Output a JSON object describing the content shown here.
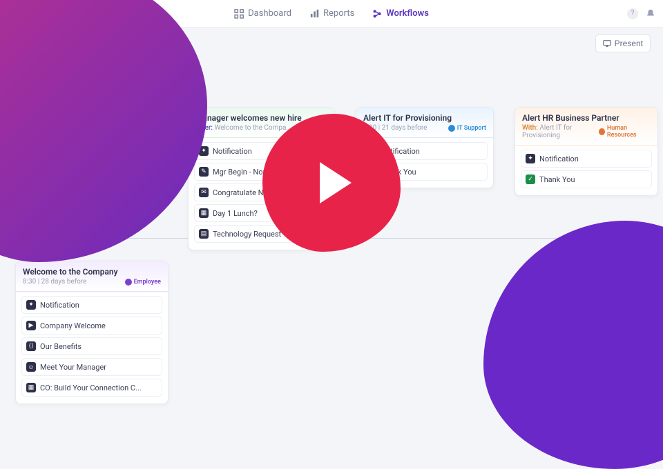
{
  "nav": {
    "items": [
      {
        "label": "Dashboard",
        "active": false
      },
      {
        "label": "Reports",
        "active": false
      },
      {
        "label": "Workflows",
        "active": true
      }
    ]
  },
  "toolbar": {
    "present_label": "Present"
  },
  "cards": {
    "welcome": {
      "title": "Welcome to the Company",
      "subtitle_time": "8:30 | 28 days before",
      "role": "Employee",
      "tasks": [
        {
          "icon": "bell",
          "label": "Notification"
        },
        {
          "icon": "play",
          "label": "Company Welcome"
        },
        {
          "icon": "code",
          "label": "Our Benefits"
        },
        {
          "icon": "user",
          "label": "Meet Your Manager"
        },
        {
          "icon": "cal",
          "label": "CO: Build Your Connection C..."
        }
      ]
    },
    "manager": {
      "title": "Manager welcomes new hire",
      "subtitle_prefix": "After:",
      "subtitle_text": "Welcome to the Compa...",
      "tasks": [
        {
          "icon": "bell",
          "label": "Notification"
        },
        {
          "icon": "doc",
          "label": "Mgr Begin - Norma..."
        },
        {
          "icon": "note",
          "label": "Congratulate New"
        },
        {
          "icon": "cal",
          "label": "Day 1 Lunch?"
        },
        {
          "icon": "grid",
          "label": "Technology Request"
        }
      ]
    },
    "it": {
      "title": "Alert IT for Provisioning",
      "subtitle_time": "8:30 | 21 days before",
      "role": "IT Support",
      "tasks": [
        {
          "icon": "bell",
          "label": "Notification"
        },
        {
          "icon": "check",
          "label": "Thank You"
        }
      ]
    },
    "hr": {
      "title": "Alert HR Business Partner",
      "subtitle_prefix": "With:",
      "subtitle_text": "Alert IT for Provisioning",
      "role": "Human Resources",
      "tasks": [
        {
          "icon": "bell",
          "label": "Notification"
        },
        {
          "icon": "check",
          "label": "Thank You"
        }
      ]
    }
  }
}
